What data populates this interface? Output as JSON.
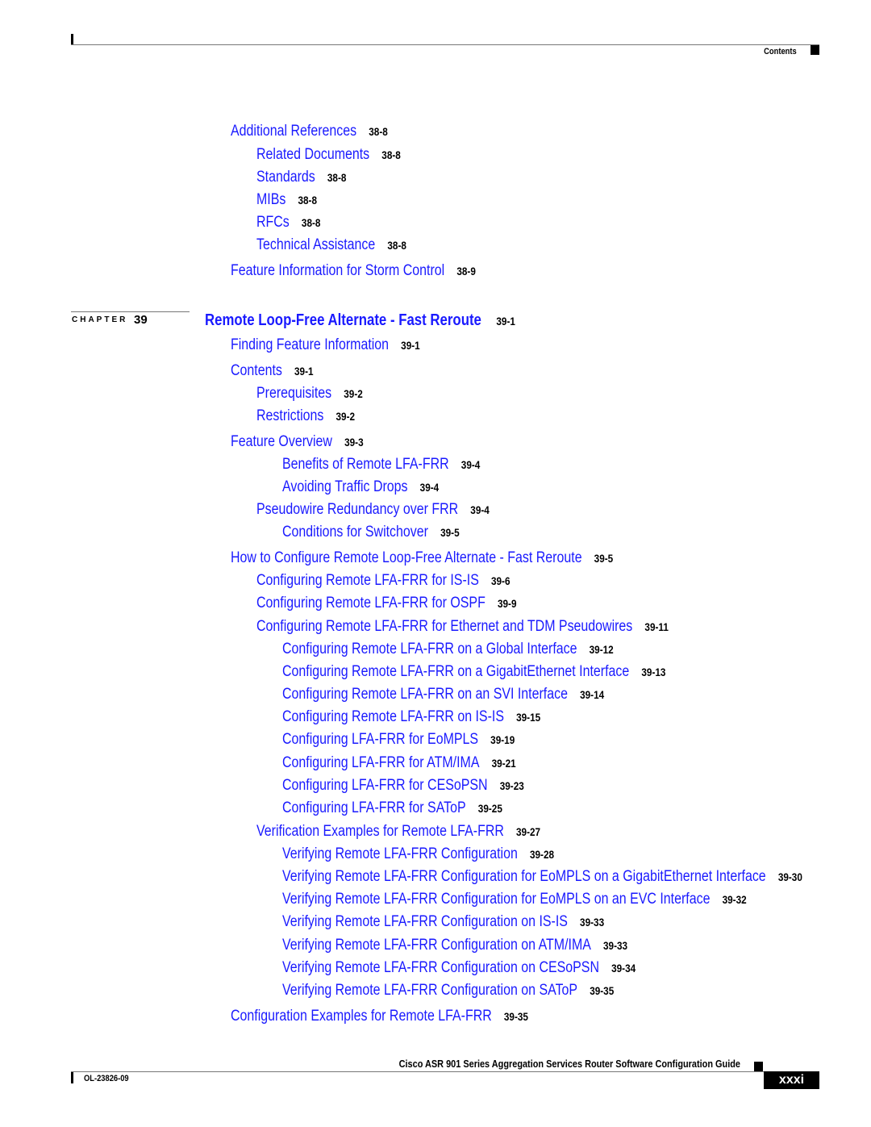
{
  "header": {
    "section_label": "Contents"
  },
  "entries_before": [
    {
      "title": "Additional References",
      "page": "38-8",
      "level": 1
    },
    {
      "title": "Related Documents",
      "page": "38-8",
      "level": 2
    },
    {
      "title": "Standards",
      "page": "38-8",
      "level": 2
    },
    {
      "title": "MIBs",
      "page": "38-8",
      "level": 2
    },
    {
      "title": "RFCs",
      "page": "38-8",
      "level": 2
    },
    {
      "title": "Technical Assistance",
      "page": "38-8",
      "level": 2
    },
    {
      "title": "Feature Information for Storm Control",
      "page": "38-9",
      "level": 1
    }
  ],
  "chapter": {
    "label": "CHAPTER",
    "number": "39",
    "title": "Remote Loop-Free Alternate - Fast Reroute",
    "page": "39-1"
  },
  "entries": [
    {
      "title": "Finding Feature Information",
      "page": "39-1",
      "level": 1
    },
    {
      "title": "Contents",
      "page": "39-1",
      "level": 1
    },
    {
      "title": "Prerequisites",
      "page": "39-2",
      "level": 2
    },
    {
      "title": "Restrictions",
      "page": "39-2",
      "level": 2
    },
    {
      "title": "Feature Overview",
      "page": "39-3",
      "level": 1
    },
    {
      "title": "Benefits of Remote LFA-FRR",
      "page": "39-4",
      "level": 3
    },
    {
      "title": "Avoiding Traffic Drops",
      "page": "39-4",
      "level": 3
    },
    {
      "title": "Pseudowire Redundancy over FRR",
      "page": "39-4",
      "level": 2
    },
    {
      "title": "Conditions for Switchover",
      "page": "39-5",
      "level": 3
    },
    {
      "title": "How to Configure Remote Loop-Free Alternate - Fast Reroute",
      "page": "39-5",
      "level": 1
    },
    {
      "title": "Configuring Remote LFA-FRR for IS-IS",
      "page": "39-6",
      "level": 2
    },
    {
      "title": "Configuring Remote LFA-FRR for OSPF",
      "page": "39-9",
      "level": 2
    },
    {
      "title": "Configuring Remote LFA-FRR for Ethernet and TDM Pseudowires",
      "page": "39-11",
      "level": 2
    },
    {
      "title": "Configuring Remote LFA-FRR on a Global Interface",
      "page": "39-12",
      "level": 3
    },
    {
      "title": "Configuring Remote LFA-FRR on a GigabitEthernet Interface",
      "page": "39-13",
      "level": 3
    },
    {
      "title": "Configuring Remote LFA-FRR on an SVI Interface",
      "page": "39-14",
      "level": 3
    },
    {
      "title": "Configuring Remote LFA-FRR on IS-IS",
      "page": "39-15",
      "level": 3
    },
    {
      "title": "Configuring LFA-FRR for EoMPLS",
      "page": "39-19",
      "level": 3
    },
    {
      "title": "Configuring LFA-FRR for ATM/IMA",
      "page": "39-21",
      "level": 3
    },
    {
      "title": "Configuring LFA-FRR for CESoPSN",
      "page": "39-23",
      "level": 3
    },
    {
      "title": "Configuring LFA-FRR for SAToP",
      "page": "39-25",
      "level": 3
    },
    {
      "title": "Verification Examples for Remote LFA-FRR",
      "page": "39-27",
      "level": 2
    },
    {
      "title": "Verifying Remote LFA-FRR Configuration",
      "page": "39-28",
      "level": 3
    },
    {
      "title": "Verifying Remote LFA-FRR Configuration for EoMPLS on a GigabitEthernet Interface",
      "page": "39-30",
      "level": 3
    },
    {
      "title": "Verifying Remote LFA-FRR Configuration for EoMPLS on an EVC Interface",
      "page": "39-32",
      "level": 3
    },
    {
      "title": "Verifying Remote LFA-FRR Configuration on IS-IS",
      "page": "39-33",
      "level": 3
    },
    {
      "title": "Verifying Remote LFA-FRR Configuration on ATM/IMA",
      "page": "39-33",
      "level": 3
    },
    {
      "title": "Verifying Remote LFA-FRR Configuration on CESoPSN",
      "page": "39-34",
      "level": 3
    },
    {
      "title": "Verifying Remote LFA-FRR Configuration on SAToP",
      "page": "39-35",
      "level": 3
    },
    {
      "title": "Configuration Examples for Remote LFA-FRR",
      "page": "39-35",
      "level": 1
    }
  ],
  "footer": {
    "guide_title": "Cisco ASR 901 Series Aggregation Services Router Software Configuration Guide",
    "doc_number": "OL-23826-09",
    "page_number": "xxxi"
  },
  "colors": {
    "link": "#1a1aff",
    "text": "#000000"
  }
}
